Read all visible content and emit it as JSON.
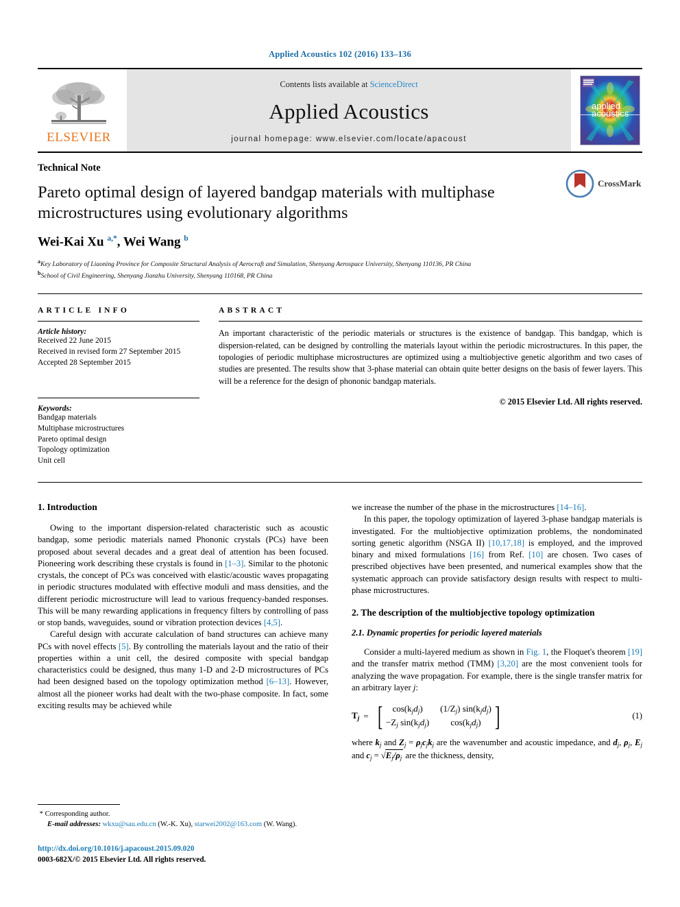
{
  "running_head": "Applied Acoustics 102 (2016) 133–136",
  "masthead": {
    "publisher_name": "ELSEVIER",
    "contents_prefix": "Contents lists available at ",
    "contents_link": "ScienceDirect",
    "journal_title": "Applied Acoustics",
    "homepage": "journal homepage: www.elsevier.com/locate/apacoust",
    "cover_line1": "applied",
    "cover_line2": "acoustics"
  },
  "article": {
    "doctype": "Technical Note",
    "title": "Pareto optimal design of layered bandgap materials with multiphase microstructures using evolutionary algorithms",
    "authors": "Wei-Kai Xu ",
    "author1_sup": "a,*",
    "authors_mid": ", Wei Wang ",
    "author2_sup": "b",
    "affiliation_a": "Key Laboratory of Liaoning Province for Composite Structural Analysis of Aerocraft and Simulation, Shenyang Aerospace University, Shenyang 110136, PR China",
    "affiliation_b": "School of Civil Engineering, Shenyang Jianzhu University, Shenyang 110168, PR China",
    "crossmark_label": "CrossMark"
  },
  "info": {
    "heading": "ARTICLE INFO",
    "history_label": "Article history:",
    "history": [
      "Received 22 June 2015",
      "Received in revised form 27 September 2015",
      "Accepted 28 September 2015"
    ],
    "keywords_label": "Keywords:",
    "keywords": [
      "Bandgap materials",
      "Multiphase microstructures",
      "Pareto optimal design",
      "Topology optimization",
      "Unit cell"
    ]
  },
  "abstract": {
    "heading": "ABSTRACT",
    "text": "An important characteristic of the periodic materials or structures is the existence of bandgap. This bandgap, which is dispersion-related, can be designed by controlling the materials layout within the periodic microstructures. In this paper, the topologies of periodic multiphase microstructures are optimized using a multiobjective genetic algorithm and two cases of studies are presented. The results show that 3-phase material can obtain quite better designs on the basis of fewer layers. This will be a reference for the design of phononic bandgap materials.",
    "copyright": "© 2015 Elsevier Ltd. All rights reserved."
  },
  "sections": {
    "intro_heading": "1. Introduction",
    "intro_p1_a": "Owing to the important dispersion-related characteristic such as acoustic bandgap, some periodic materials named Phononic crystals (PCs) have been proposed about several decades and a great deal of attention has been focused. Pioneering work describing these crystals is found in ",
    "intro_p1_ref1": "[1–3]",
    "intro_p1_b": ". Similar to the photonic crystals, the concept of PCs was conceived with elastic/acoustic waves propagating in periodic structures modulated with effective moduli and mass densities, and the different periodic microstructure will lead to various frequency-banded responses. This will be many rewarding applications in frequency filters by controlling of pass or stop bands, waveguides, sound or vibration protection devices ",
    "intro_p1_ref2": "[4,5]",
    "intro_p1_c": ".",
    "intro_p2_a": "Careful design with accurate calculation of band structures can achieve many PCs with novel effects ",
    "intro_p2_ref1": "[5]",
    "intro_p2_b": ". By controlling the materials layout and the ratio of their properties within a unit cell, the desired composite with special bandgap characteristics could be designed, thus many 1-D and 2-D microstructures of PCs had been designed based on the topology optimization method ",
    "intro_p2_ref2": "[6–13]",
    "intro_p2_c": ". However, almost all the pioneer works had dealt with the two-phase composite. In fact, some exciting results may be achieved while",
    "intro_p3_a": "we increase the number of the phase in the microstructures ",
    "intro_p3_ref1": "[14–16]",
    "intro_p3_b": ".",
    "intro_p4_a": "In this paper, the topology optimization of layered 3-phase bandgap materials is investigated. For the multiobjective optimization problems, the nondominated sorting genetic algorithm (NSGA II) ",
    "intro_p4_ref1": "[10,17,18]",
    "intro_p4_b": " is employed, and the improved binary and mixed formulations ",
    "intro_p4_ref2": "[16]",
    "intro_p4_c": " from Ref. ",
    "intro_p4_ref3": "[10]",
    "intro_p4_d": " are chosen. Two cases of prescribed objectives have been presented, and numerical examples show that the systematic approach can provide satisfactory design results with respect to multi-phase microstructures.",
    "sec2_heading": "2. The description of the multiobjective topology optimization",
    "sec21_heading": "2.1. Dynamic properties for periodic layered materials",
    "sec21_p1_a": "Consider a multi-layered medium as shown in ",
    "sec21_p1_figref": "Fig. 1",
    "sec21_p1_b": ", the Floquet's theorem ",
    "sec21_p1_ref1": "[19]",
    "sec21_p1_c": " and the transfer matrix method (TMM) ",
    "sec21_p1_ref2": "[3,20]",
    "sec21_p1_d": " are the most convenient tools for analyzing the wave propagation. For example, there is the single transfer matrix for an arbitrary layer ",
    "sec21_p1_e": "j",
    "sec21_p1_f": ":"
  },
  "equation": {
    "lhs": "T",
    "lhs_sub": "j",
    "equals": "=",
    "m11": "cos(k",
    "m11_sub": "j",
    "m11_b": "d",
    "m11_sub2": "j",
    "m11_c": ")",
    "m12": "(1/Z",
    "m12_sub": "j",
    "m12_b": ") sin(k",
    "m12_sub2": "j",
    "m12_c": "d",
    "m12_sub3": "j",
    "m12_d": ")",
    "m21": "−Z",
    "m21_sub": "j",
    "m21_b": " sin(k",
    "m21_sub2": "j",
    "m21_c": "d",
    "m21_sub3": "j",
    "m21_d": ")",
    "m22": "cos(k",
    "m22_sub": "j",
    "m22_b": "d",
    "m22_sub2": "j",
    "m22_c": ")",
    "number": "(1)"
  },
  "after_eq": {
    "a": "where ",
    "k": "k",
    "ksub": "j",
    "b": " and ",
    "z": "Z",
    "zsub": "j",
    "c": " = ",
    "rho": "ρ",
    "rhosub": "j",
    "cc": "c",
    "ccsub": "j",
    "kk": "k",
    "kksub": "j",
    "d": " are the wavenumber and acoustic impedance, and ",
    "dd": "d",
    "ddsub": "j",
    "e": ", ",
    "rho2": "ρ",
    "rho2sub": "j",
    "f": ", ",
    "E": "E",
    "Esub": "j",
    "g": " and ",
    "c2": "c",
    "c2sub": "j",
    "h": " = ",
    "sqrt_content": "E",
    "sqrt_sub1": "j",
    "sqrt_mid": "/ρ",
    "sqrt_sub2": "j",
    "i": " are the thickness, density,"
  },
  "footnotes": {
    "star": "*",
    "corresponding": " Corresponding author.",
    "email_label": "E-mail addresses:",
    "email1": "wkxu@sau.edu.cn",
    "email1_name": " (W.-K. Xu), ",
    "email2": "starwei2002@163.com",
    "email2_name": " (W. Wang).",
    "doi": "http://dx.doi.org/10.1016/j.apacoust.2015.09.020",
    "issn": "0003-682X/© 2015 Elsevier Ltd. All rights reserved."
  },
  "colors": {
    "link": "#1b7bb5",
    "running_head": "#1b6ca8",
    "elsevier_orange": "#e87722",
    "band_gray": "#e4e4e4"
  }
}
